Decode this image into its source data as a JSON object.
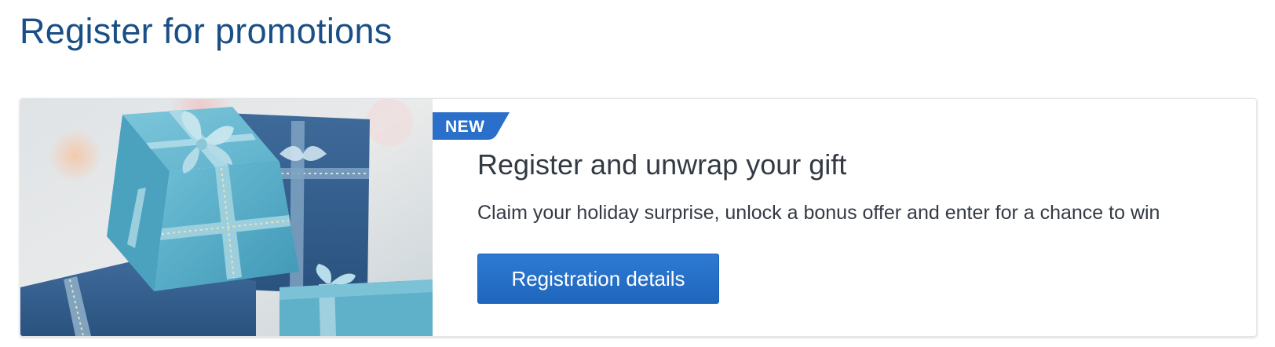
{
  "page": {
    "title": "Register for promotions"
  },
  "promo": {
    "badge": "NEW",
    "heading": "Register and unwrap your gift",
    "description": "Claim your holiday surprise, unlock a bonus offer and enter for a chance to win",
    "button_label": "Registration details",
    "image_icon": "gift-boxes-image"
  },
  "colors": {
    "title": "#1a4f86",
    "badge": "#2a6fc9",
    "button": "#2470c8",
    "text": "#333a44"
  }
}
